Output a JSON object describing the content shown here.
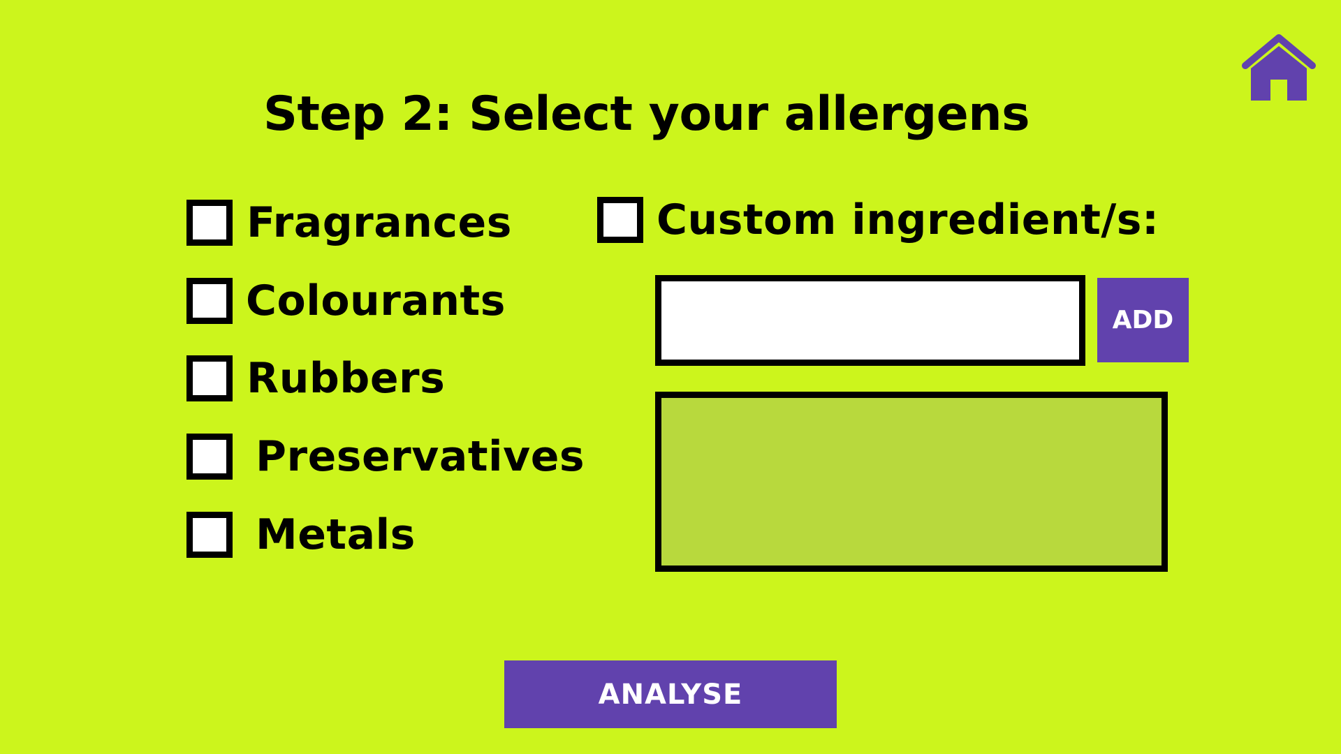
{
  "header": {
    "title": "Step 2: Select your allergens",
    "home_icon": "home-icon",
    "home_color": "#6142ad"
  },
  "allergens": [
    {
      "label": "Fragrances",
      "checked": false
    },
    {
      "label": "Colourants",
      "checked": false
    },
    {
      "label": "Rubbers",
      "checked": false
    },
    {
      "label": "Preservatives",
      "checked": false
    },
    {
      "label": "Metals",
      "checked": false
    }
  ],
  "custom": {
    "label": "Custom ingredient/s:",
    "checked": false,
    "input_value": "",
    "add_label": "ADD"
  },
  "analyse_label": "ANALYSE",
  "colors": {
    "background": "#ccf51c",
    "accent": "#6142ad",
    "list_background": "#b8d93d"
  }
}
